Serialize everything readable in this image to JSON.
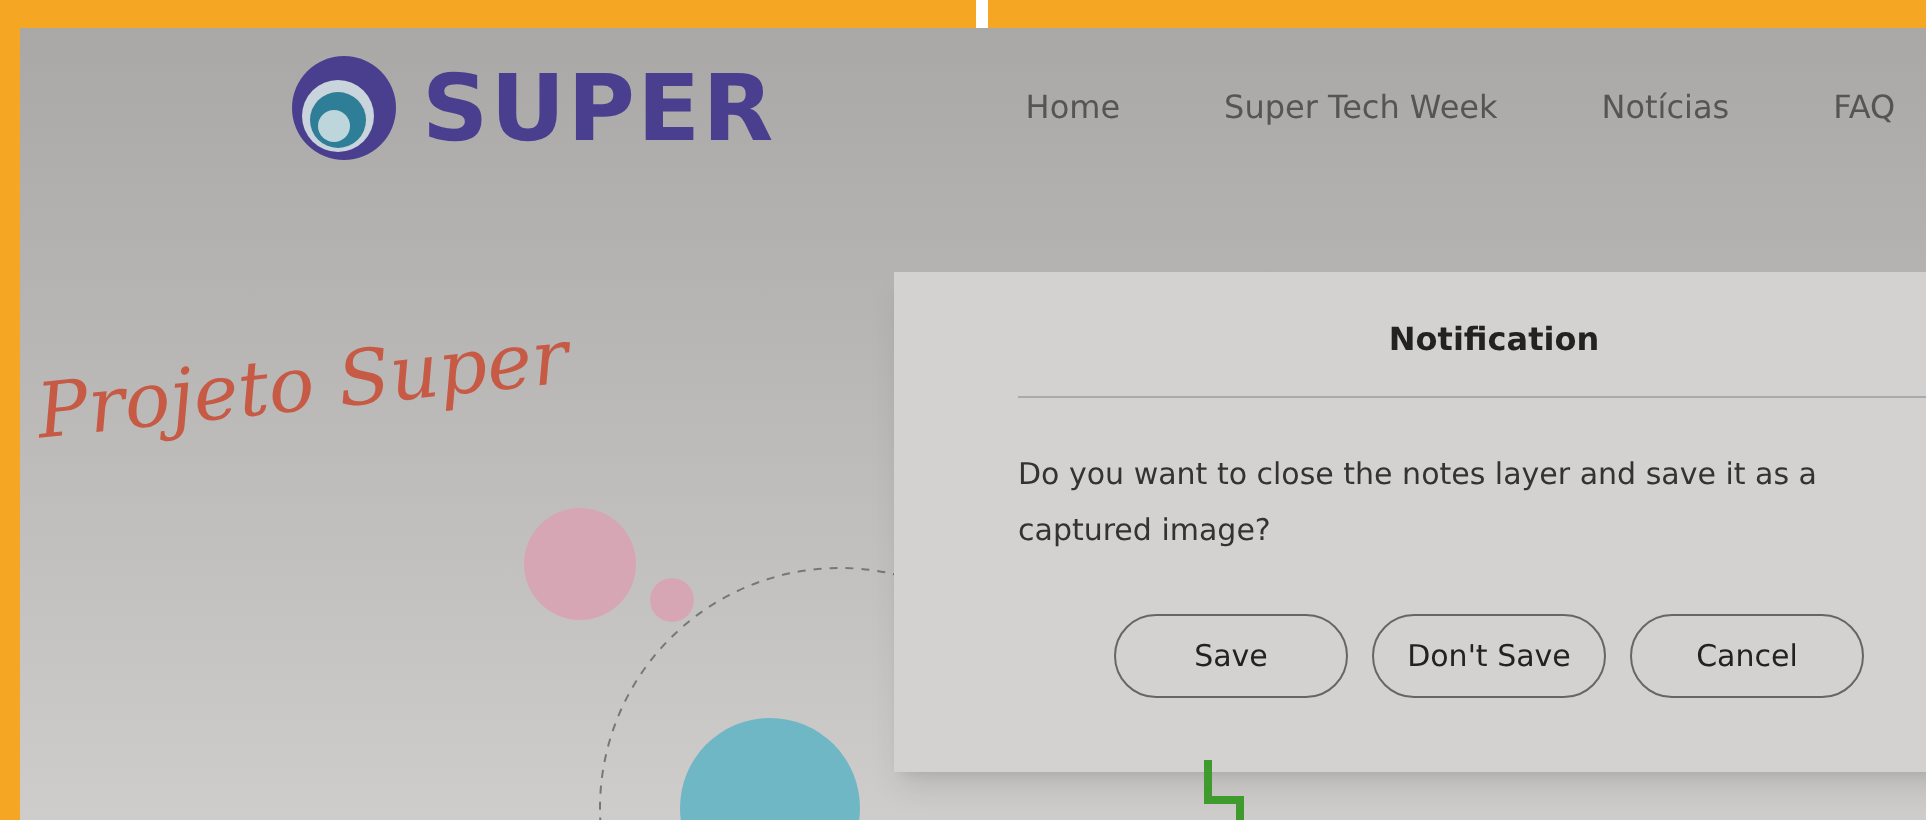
{
  "header": {
    "logo_text": "SUPER",
    "nav": [
      {
        "label": "Home"
      },
      {
        "label": "Super Tech Week"
      },
      {
        "label": "Notícias"
      },
      {
        "label": "FAQ"
      }
    ]
  },
  "handwritten_note": "Projeto Super",
  "dialog": {
    "title": "Notification",
    "message": "Do you want to close the notes layer and save it as a captured image?",
    "buttons": [
      {
        "label": "Save"
      },
      {
        "label": "Don't Save"
      },
      {
        "label": "Cancel"
      }
    ]
  }
}
